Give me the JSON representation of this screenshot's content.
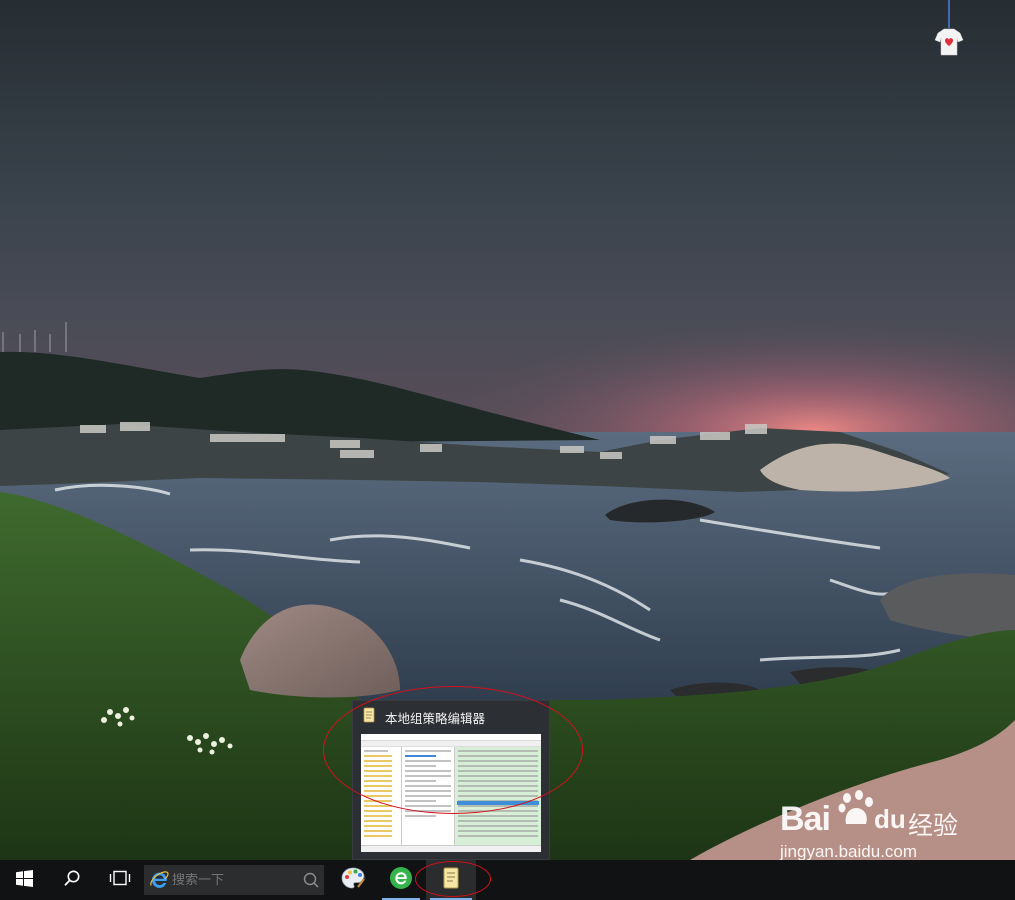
{
  "desktop": {
    "widget_icon": "tshirt-heart-icon"
  },
  "taskbar": {
    "start_icon": "windows-logo-icon",
    "cortana_icon": "search-icon",
    "taskview_icon": "task-view-icon",
    "search_placeholder": "搜索一下",
    "search_engine_icon": "ie-logo-icon",
    "pinned": [
      {
        "name": "paint-palette-app",
        "icon": "paint-palette-icon",
        "active": false
      },
      {
        "name": "green-e-app",
        "icon": "green-e-icon",
        "active": true
      },
      {
        "name": "group-policy-editor",
        "icon": "notepad-scroll-icon",
        "active": true,
        "hovered": true
      }
    ]
  },
  "preview": {
    "title": "本地组策略编辑器",
    "icon": "notepad-scroll-icon"
  },
  "watermark": {
    "brand": "Bai",
    "brand_suffix": "du",
    "brand_cn": "经验",
    "url": "jingyan.baidu.com"
  },
  "colors": {
    "annotation_red": "#d4101b",
    "taskbar_bg": "#101214",
    "active_underline": "#7fb3e8",
    "preview_bg": "#2c2f33"
  }
}
